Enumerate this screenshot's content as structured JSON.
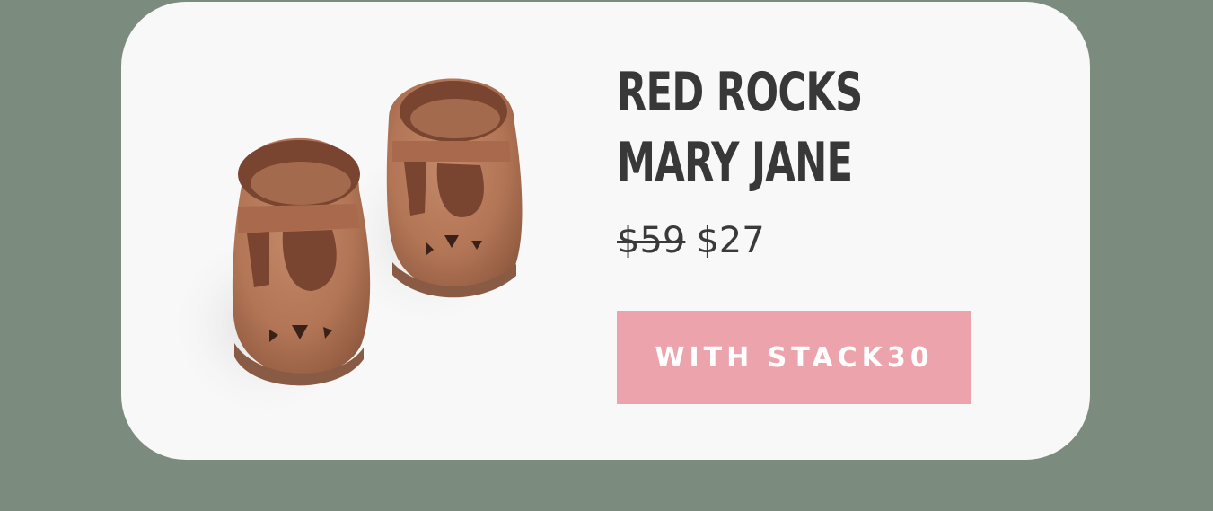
{
  "product": {
    "title_line1": "RED ROCKS",
    "title_line2": "MARY JANE",
    "image_icon": "baby-mary-jane-moccasins-image",
    "original_price": "$59",
    "sale_price": "$27"
  },
  "cta": {
    "label": "WITH STACK30"
  },
  "colors": {
    "background": "#7b8c7f",
    "card": "#f8f8f8",
    "title": "#383838",
    "button": "#eca3ab",
    "button_text": "#ffffff",
    "leather": "#b57a5c"
  }
}
